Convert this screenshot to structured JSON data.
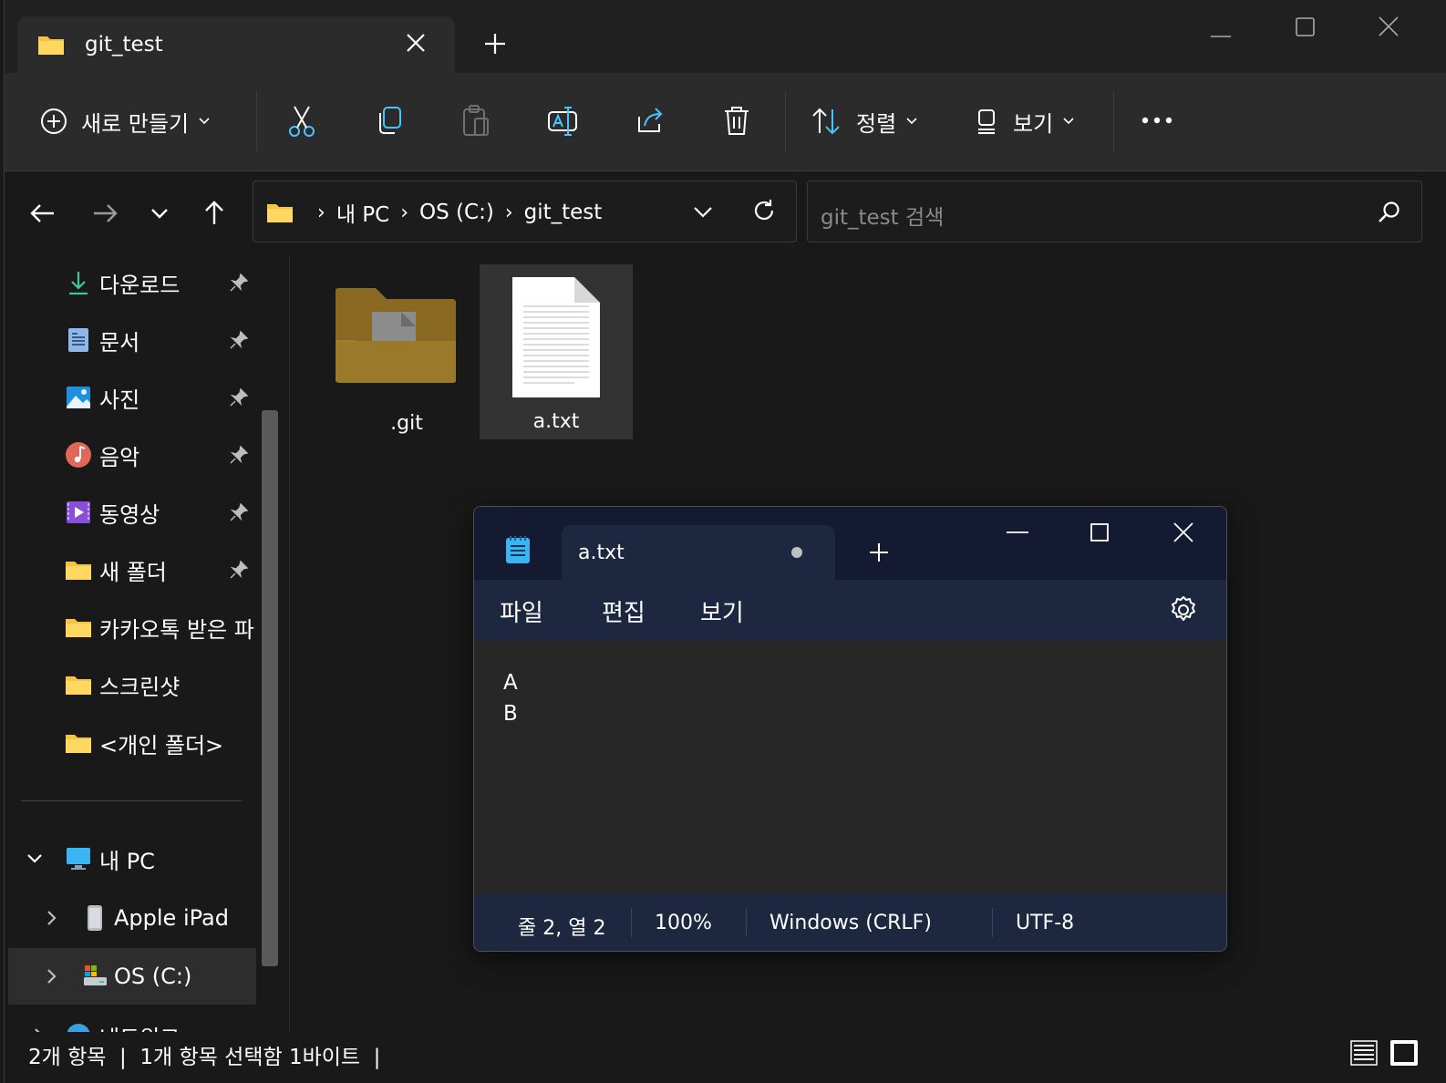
{
  "explorer": {
    "tab_title": "git_test",
    "commands": {
      "new": "새로 만들기",
      "sort": "정렬",
      "view": "보기"
    },
    "address": {
      "crumbs": [
        "내 PC",
        "OS (C:)",
        "git_test"
      ]
    },
    "search": {
      "placeholder": "git_test 검색"
    },
    "sidebar": {
      "pinned": [
        {
          "label": "다운로드",
          "icon": "download-icon"
        },
        {
          "label": "문서",
          "icon": "document-icon"
        },
        {
          "label": "사진",
          "icon": "picture-icon"
        },
        {
          "label": "음악",
          "icon": "music-icon"
        },
        {
          "label": "동영상",
          "icon": "video-icon"
        },
        {
          "label": "새 폴더",
          "icon": "folder-icon"
        }
      ],
      "folders": [
        {
          "label": "카카오톡 받은 파",
          "icon": "folder-icon"
        },
        {
          "label": "스크린샷",
          "icon": "folder-icon"
        },
        {
          "label": "<개인 폴더>",
          "icon": "folder-icon"
        }
      ],
      "tree": [
        {
          "label": "내 PC",
          "icon": "computer-icon"
        },
        {
          "label": "Apple iPad",
          "icon": "device-icon"
        },
        {
          "label": "OS (C:)",
          "icon": "drive-icon"
        },
        {
          "label": "네트워크",
          "icon": "network-icon"
        }
      ]
    },
    "files": [
      {
        "name": ".git",
        "icon": "folder-icon"
      },
      {
        "name": "a.txt",
        "icon": "text-file-icon"
      }
    ],
    "status": "2개 항목  |  1개 항목 선택함 1바이트  |"
  },
  "notepad": {
    "tab_title": "a.txt",
    "menu": {
      "file": "파일",
      "edit": "편집",
      "view": "보기"
    },
    "lines": [
      "A",
      "B"
    ],
    "status": {
      "position": "줄 2, 열 2",
      "zoom": "100%",
      "line_ending": "Windows (CRLF)",
      "encoding": "UTF-8"
    }
  },
  "colors": {
    "accent": "#4cc2ff",
    "folder": "#f5c542",
    "notepad_title": "#131a32",
    "notepad_menu": "#1e2740"
  }
}
